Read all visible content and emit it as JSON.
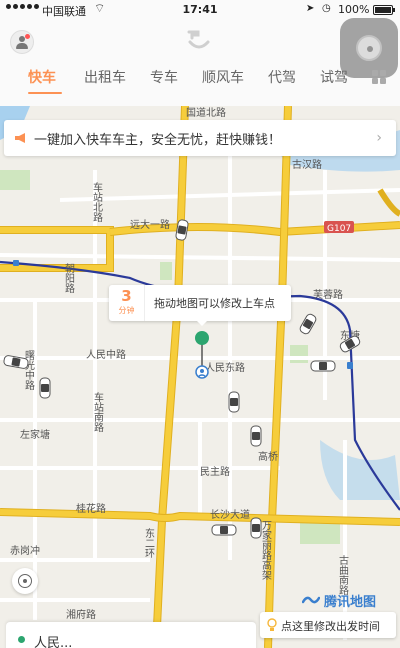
{
  "status_bar": {
    "carrier": "中国联通",
    "time": "17:41",
    "battery": "100%",
    "battery_level": 1.0
  },
  "header": {
    "tabs": [
      {
        "label": "快车",
        "active": true
      },
      {
        "label": "出租车",
        "active": false
      },
      {
        "label": "专车",
        "active": false
      },
      {
        "label": "顺风车",
        "active": false
      },
      {
        "label": "代驾",
        "active": false
      },
      {
        "label": "试驾",
        "active": false
      }
    ]
  },
  "banner": {
    "text": "一键加入快车车主，安全无忧，赶快赚钱！",
    "chevron": "›"
  },
  "pickup_hint": {
    "eta_value": "3",
    "eta_unit": "分钟",
    "message": "拖动地图可以修改上车点"
  },
  "map": {
    "road_labels": {
      "gu_han": "古汉路",
      "guo_bei": "国道北路",
      "hu_hua": "芙蓉路",
      "yuan_da_yi": "远大一路",
      "g107": "G107",
      "chao_yang": "朝阳路",
      "ren_min_zhong": "人民中路",
      "ren_min_dong": "人民东路",
      "fu_rong": "芙蓉中路",
      "dong_tang": "东塘",
      "che_zhan_bei": "车站北路",
      "che_zhan_nan": "车站南路",
      "ying_zhong": "曙光中路",
      "zuo_jia_tang": "左家塘",
      "min_zhu": "民主路",
      "gao_qiao": "高桥",
      "gui_hua": "桂花路",
      "chang_sha_da_dao": "长沙大道",
      "dong_er_huan": "东二环",
      "wan_jia_li": "万家丽路高架",
      "gu_qu": "古曲南路",
      "chi_gang_chong": "赤岗冲",
      "xiang_zhang": "湘府路"
    },
    "logo_text": "腾讯地图",
    "colors": {
      "road_major": "#f6cd3b",
      "road_major_edge": "#e0b020",
      "road_minor": "#ffffff",
      "metro_line": "#2b3a9a",
      "water": "#a8d1ef",
      "park": "#cfe6bf",
      "accent": "#fc9153"
    }
  },
  "modify_tip": {
    "text": "点这里修改出发时间"
  },
  "bottom_card": {
    "origin_text": "人民..."
  },
  "icons": {
    "avatar": "user-icon",
    "assist": "assistive-touch-icon",
    "locate": "locate-icon",
    "megaphone": "megaphone-icon",
    "bulb": "bulb-icon",
    "pin": "map-pin-icon",
    "logo": "didi-logo-icon",
    "grid": "grid-icon"
  }
}
